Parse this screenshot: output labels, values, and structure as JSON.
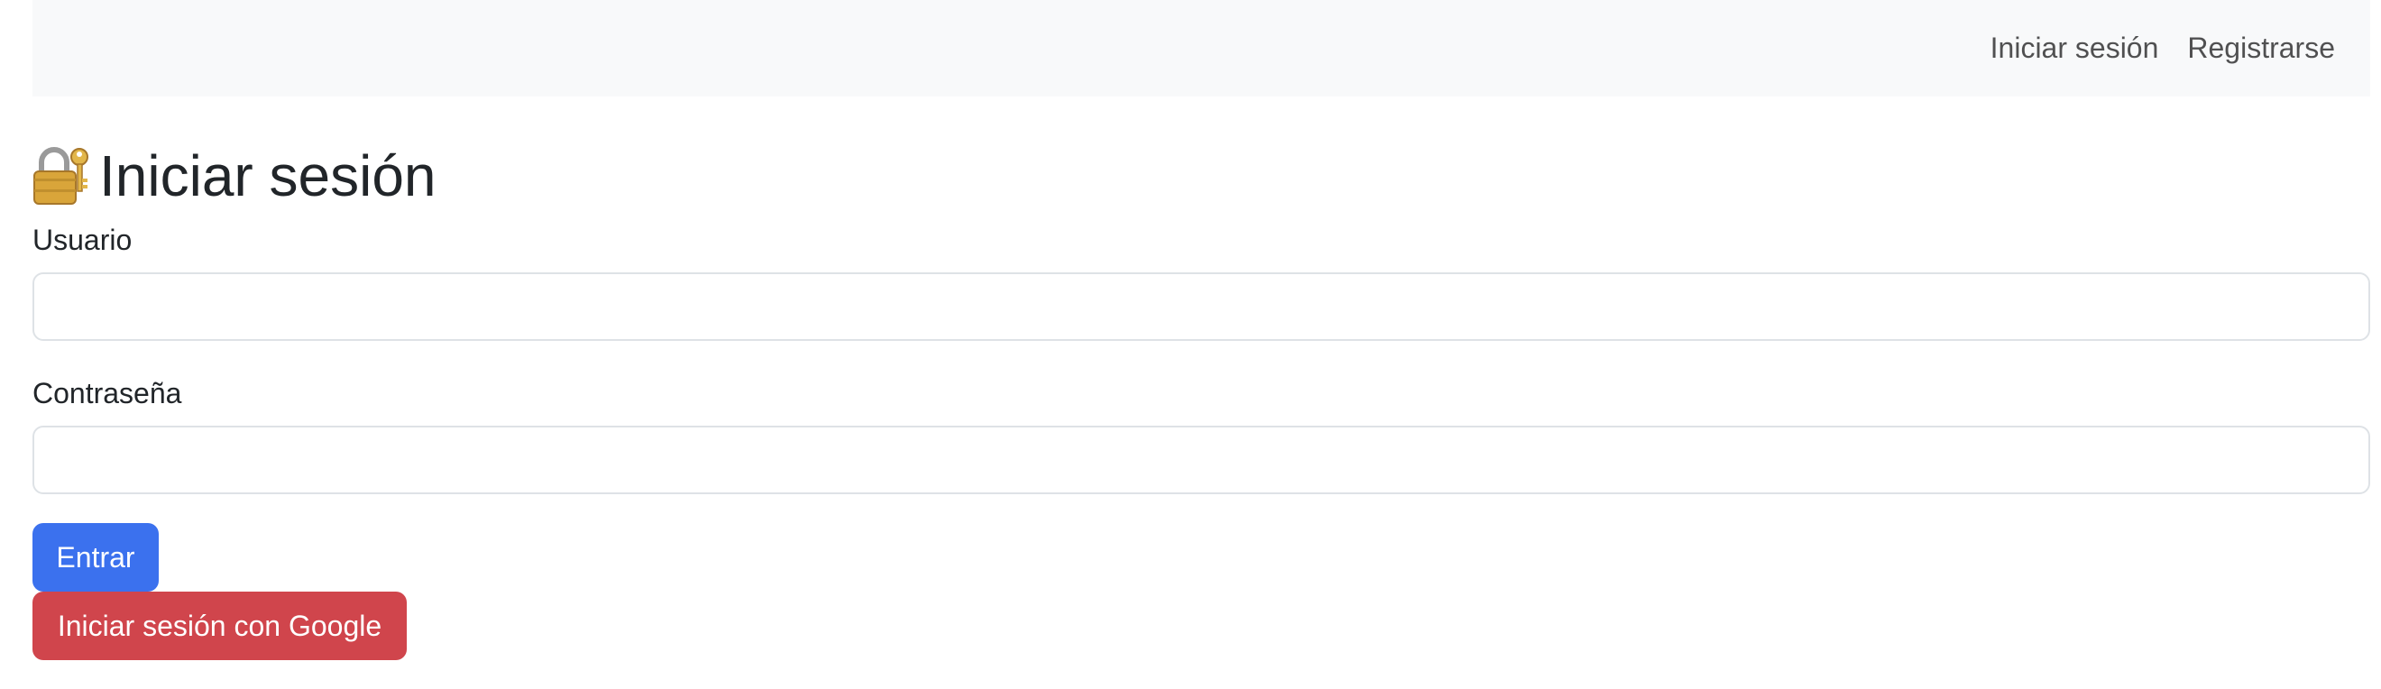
{
  "navbar": {
    "links": [
      {
        "label": "Iniciar sesión"
      },
      {
        "label": "Registrarse"
      }
    ]
  },
  "page": {
    "title": "Iniciar sesión",
    "title_icon": "locked-with-key-icon"
  },
  "form": {
    "username": {
      "label": "Usuario",
      "value": "",
      "placeholder": ""
    },
    "password": {
      "label": "Contraseña",
      "value": "",
      "placeholder": ""
    },
    "submit_label": "Entrar",
    "google_label": "Iniciar sesión con Google"
  },
  "colors": {
    "navbar_bg": "#f8f9fa",
    "primary": "#3b71ee",
    "danger": "#d0454c",
    "text": "#212529"
  }
}
